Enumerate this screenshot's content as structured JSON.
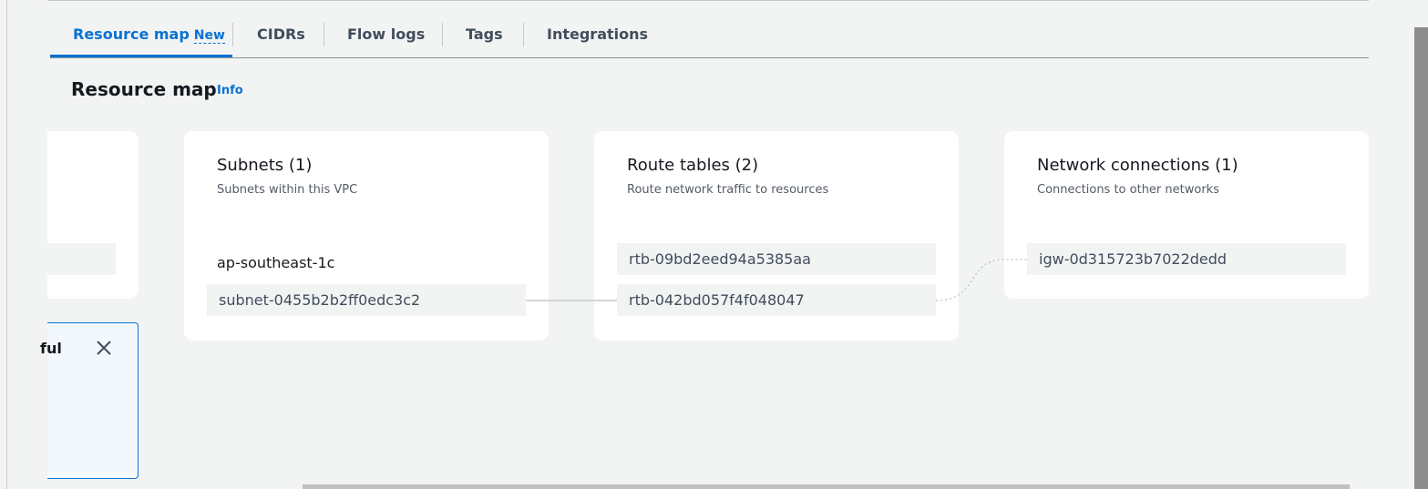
{
  "tabs": [
    {
      "label": "Resource map",
      "badge": "New"
    },
    {
      "label": "CIDRs"
    },
    {
      "label": "Flow logs"
    },
    {
      "label": "Tags"
    },
    {
      "label": "Integrations"
    }
  ],
  "section": {
    "title": "Resource map",
    "info": "Info"
  },
  "subnets": {
    "title": "Subnets (1)",
    "subtitle": "Subnets within this VPC",
    "az": "ap-southeast-1c",
    "items": [
      "subnet-0455b2b2ff0edc3c2"
    ]
  },
  "route_tables": {
    "title": "Route tables (2)",
    "subtitle": "Route network traffic to resources",
    "items": [
      "rtb-09bd2eed94a5385aa",
      "rtb-042bd057f4f048047"
    ]
  },
  "network_connections": {
    "title": "Network connections (1)",
    "subtitle": "Connections to other networks",
    "items": [
      "igw-0d315723b7022dedd"
    ]
  },
  "flash": {
    "text": "ful",
    "close_icon": "close-icon"
  },
  "colors": {
    "accent": "#0972d3",
    "background": "#f2f3f3",
    "card": "#ffffff"
  }
}
